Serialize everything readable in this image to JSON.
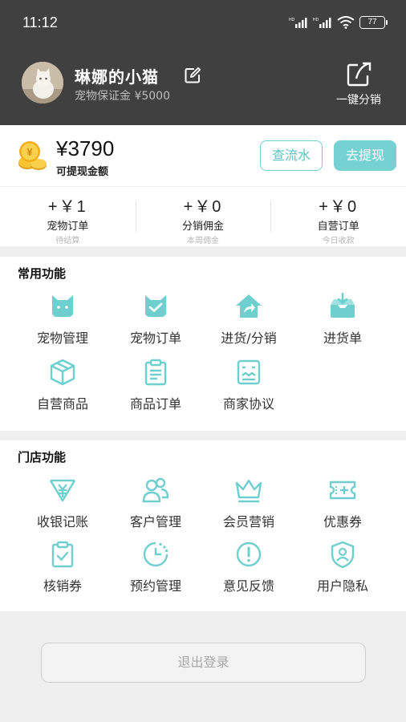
{
  "status_bar": {
    "time": "11:12",
    "battery": "77"
  },
  "profile": {
    "name": "琳娜的小猫",
    "deposit": "宠物保证金 ¥5000",
    "share_label": "一键分销"
  },
  "balance": {
    "amount": "¥3790",
    "label": "可提现金额",
    "flow_button": "查流水",
    "withdraw_button": "去提现"
  },
  "stats": [
    {
      "value": "+￥1",
      "label": "宠物订单",
      "sub": "待结算"
    },
    {
      "value": "+￥0",
      "label": "分销佣金",
      "sub": "本周佣金"
    },
    {
      "value": "+￥0",
      "label": "自营订单",
      "sub": "今日收款"
    }
  ],
  "common_functions": {
    "title": "常用功能",
    "items": [
      {
        "label": "宠物管理",
        "icon": "cat-face-icon"
      },
      {
        "label": "宠物订单",
        "icon": "cat-check-icon"
      },
      {
        "label": "进货/分销",
        "icon": "house-share-icon"
      },
      {
        "label": "进货单",
        "icon": "inbox-download-icon"
      },
      {
        "label": "自营商品",
        "icon": "box-icon"
      },
      {
        "label": "商品订单",
        "icon": "clipboard-icon"
      },
      {
        "label": "商家协议",
        "icon": "agreement-icon"
      }
    ]
  },
  "store_functions": {
    "title": "门店功能",
    "items": [
      {
        "label": "收银记账",
        "icon": "cashier-icon"
      },
      {
        "label": "客户管理",
        "icon": "customers-icon"
      },
      {
        "label": "会员营销",
        "icon": "crown-icon"
      },
      {
        "label": "优惠券",
        "icon": "coupon-icon"
      },
      {
        "label": "核销券",
        "icon": "verify-coupon-icon"
      },
      {
        "label": "预约管理",
        "icon": "clock-icon"
      },
      {
        "label": "意见反馈",
        "icon": "feedback-icon"
      },
      {
        "label": "用户隐私",
        "icon": "privacy-shield-icon"
      }
    ]
  },
  "logout_label": "退出登录",
  "colors": {
    "accent": "#76d2d2",
    "header_bg": "#404040",
    "icon_teal": "#6fcfcf"
  }
}
